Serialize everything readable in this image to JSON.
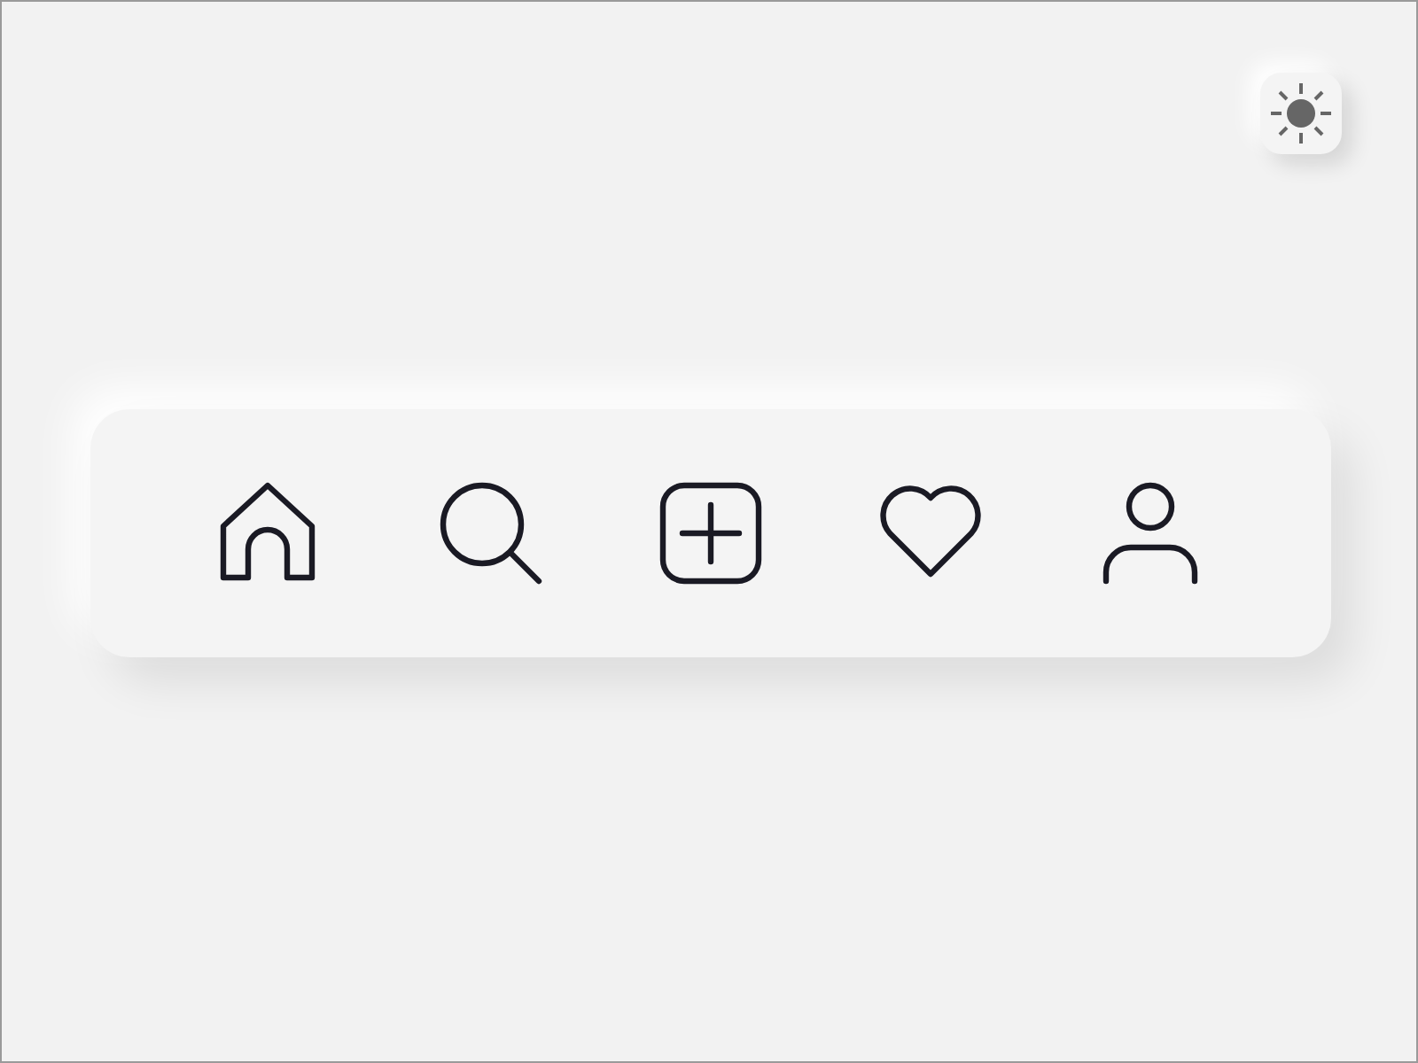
{
  "theme_toggle": {
    "kind": "sun"
  },
  "nav_bar": {
    "items": [
      {
        "kind": "home"
      },
      {
        "kind": "search"
      },
      {
        "kind": "add"
      },
      {
        "kind": "heart"
      },
      {
        "kind": "profile"
      }
    ]
  }
}
